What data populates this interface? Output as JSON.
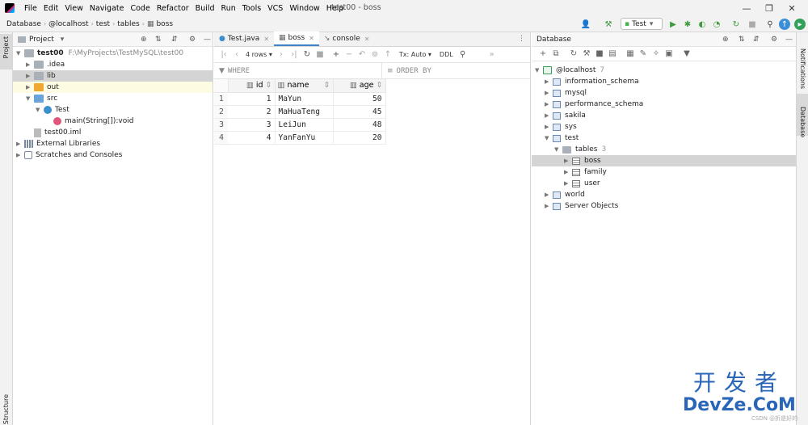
{
  "window": {
    "title": "test00 - boss"
  },
  "menu": [
    "File",
    "Edit",
    "View",
    "Navigate",
    "Code",
    "Refactor",
    "Build",
    "Run",
    "Tools",
    "VCS",
    "Window",
    "Help"
  ],
  "breadcrumb": [
    "Database",
    "@localhost",
    "test",
    "tables",
    "boss"
  ],
  "run_config": {
    "label": "Test"
  },
  "stripes": {
    "left_top": "Project",
    "left_bottom": "Structure",
    "right_notifications": "Notifications",
    "right_database": "Database"
  },
  "project_panel": {
    "title": "Project",
    "tree": [
      {
        "label": "test00",
        "extra": "F:\\MyProjects\\TestMySQL\\test00",
        "indent": 0,
        "arrow": "v",
        "icon": "folder-grey",
        "bold": true
      },
      {
        "label": ".idea",
        "indent": 1,
        "arrow": ">",
        "icon": "folder-grey"
      },
      {
        "label": "lib",
        "indent": 1,
        "arrow": ">",
        "icon": "folder-grey",
        "selected": true
      },
      {
        "label": "out",
        "indent": 1,
        "arrow": ">",
        "icon": "folder-orange",
        "highlight": true
      },
      {
        "label": "src",
        "indent": 1,
        "arrow": "v",
        "icon": "folder-blue"
      },
      {
        "label": "Test",
        "indent": 2,
        "arrow": "v",
        "icon": "class-icon"
      },
      {
        "label": "main(String[]):void",
        "indent": 3,
        "arrow": "",
        "icon": "method-icon"
      },
      {
        "label": "test00.iml",
        "indent": 1,
        "arrow": "",
        "icon": "file-icon"
      },
      {
        "label": "External Libraries",
        "indent": 0,
        "arrow": ">",
        "icon": "library-icon"
      },
      {
        "label": "Scratches and Consoles",
        "indent": 0,
        "arrow": ">",
        "icon": "scratch-icon"
      }
    ]
  },
  "editor": {
    "tabs": [
      {
        "label": "Test.java",
        "active": false
      },
      {
        "label": "boss",
        "active": true
      },
      {
        "label": "console",
        "active": false
      }
    ],
    "toolbar": {
      "rows": "4 rows",
      "tx": "Tx: Auto",
      "ddl": "DDL"
    },
    "filter": {
      "where": "WHERE",
      "order_by": "ORDER BY"
    },
    "grid": {
      "columns": [
        "id",
        "name",
        "age"
      ],
      "rows": [
        {
          "n": "1",
          "id": "1",
          "name": "MaYun",
          "age": "50"
        },
        {
          "n": "2",
          "id": "2",
          "name": "MaHuaTeng",
          "age": "45"
        },
        {
          "n": "3",
          "id": "3",
          "name": "LeiJun",
          "age": "48"
        },
        {
          "n": "4",
          "id": "4",
          "name": "YanFanYu",
          "age": "20"
        }
      ]
    }
  },
  "database_panel": {
    "title": "Database",
    "tree": [
      {
        "label": "@localhost",
        "extra": "7",
        "indent": 0,
        "arrow": "v",
        "icon": "host"
      },
      {
        "label": "information_schema",
        "indent": 1,
        "arrow": ">",
        "icon": "db"
      },
      {
        "label": "mysql",
        "indent": 1,
        "arrow": ">",
        "icon": "db"
      },
      {
        "label": "performance_schema",
        "indent": 1,
        "arrow": ">",
        "icon": "db"
      },
      {
        "label": "sakila",
        "indent": 1,
        "arrow": ">",
        "icon": "db"
      },
      {
        "label": "sys",
        "indent": 1,
        "arrow": ">",
        "icon": "db"
      },
      {
        "label": "test",
        "indent": 1,
        "arrow": "v",
        "icon": "db"
      },
      {
        "label": "tables",
        "extra": "3",
        "indent": 2,
        "arrow": "v",
        "icon": "folder"
      },
      {
        "label": "boss",
        "indent": 3,
        "arrow": ">",
        "icon": "table",
        "selected": true
      },
      {
        "label": "family",
        "indent": 3,
        "arrow": ">",
        "icon": "table"
      },
      {
        "label": "user",
        "indent": 3,
        "arrow": ">",
        "icon": "table"
      },
      {
        "label": "world",
        "indent": 1,
        "arrow": ">",
        "icon": "db"
      },
      {
        "label": "Server Objects",
        "indent": 1,
        "arrow": ">",
        "icon": "db"
      }
    ]
  },
  "watermark": {
    "cn": "开发者",
    "en": "DevZe.CoM",
    "csdn": "CSDN @折是好的"
  },
  "colors": {
    "accent": "#4083c9",
    "selection": "#d4d4d4",
    "highlight": "#fdfbe1",
    "watermark": "#2a66b8"
  }
}
